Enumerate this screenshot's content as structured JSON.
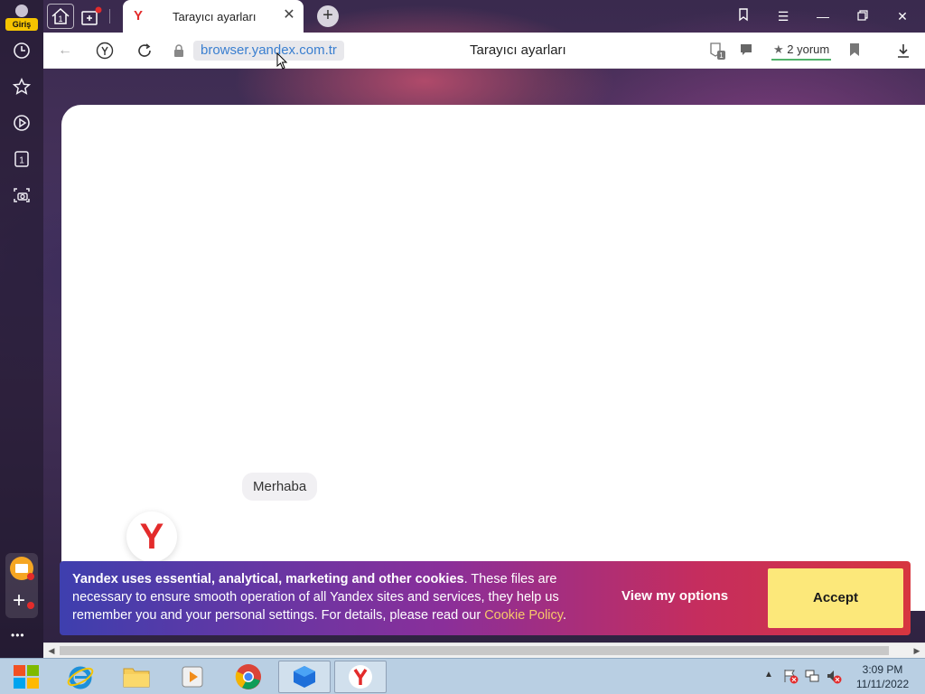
{
  "sidebar": {
    "login_label": "Giriş",
    "tab_count_icon": "1",
    "items": [
      {
        "icon": "history-icon"
      },
      {
        "icon": "bookmarks-star-icon"
      },
      {
        "icon": "play-icon"
      },
      {
        "icon": "collections-icon"
      },
      {
        "icon": "screenshot-camera-icon"
      }
    ],
    "more_label": "•••"
  },
  "tabbar": {
    "home_count": "1",
    "tab": {
      "title": "Tarayıcı ayarları",
      "favicon": "Y",
      "close": "✕"
    },
    "new_tab": "+"
  },
  "addressbar": {
    "url": "browser.yandex.com.tr",
    "page_title": "Tarayıcı ayarları",
    "reviews": "2 yorum",
    "reviews_star": "★",
    "privacy_count": "1"
  },
  "content": {
    "greeting": "Merhaba",
    "logo_letter": "Y"
  },
  "cookie_banner": {
    "text_bold": "Yandex uses essential, analytical, marketing and other cookies",
    "text_rest": ". These files are necessary to ensure smooth operation of all Yandex sites and services, they help us remember you and your personal settings. For details, please read our ",
    "link": "Cookie Policy",
    "text_end": ".",
    "view_options": "View my options",
    "accept": "Accept"
  },
  "taskbar": {
    "time": "3:09 PM",
    "date": "11/11/2022"
  },
  "colors": {
    "accent_red": "#e32b2b",
    "link_blue": "#3a7fd0",
    "accept_yellow": "#fce87a",
    "login_yellow": "#f5c400"
  }
}
